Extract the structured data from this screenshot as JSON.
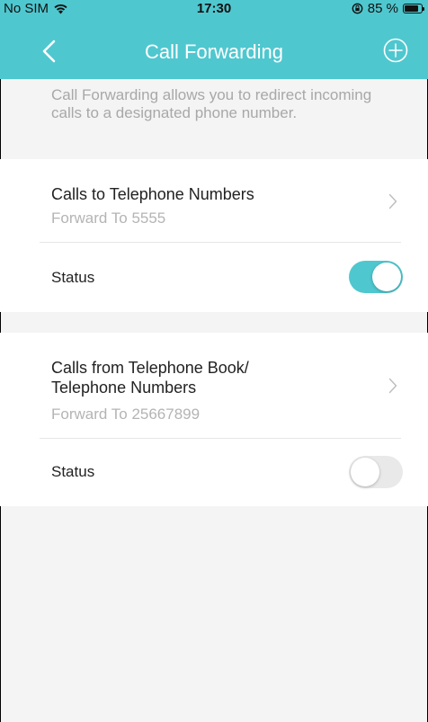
{
  "status_bar": {
    "carrier": "No SIM",
    "time": "17:30",
    "battery_text": "85 %",
    "battery_level": 0.85,
    "wifi_icon": "wifi-icon",
    "lock_icon": "orientation-lock-icon"
  },
  "header": {
    "title": "Call Forwarding",
    "back_icon": "chevron-left-icon",
    "add_icon": "plus-circle-icon",
    "color": "#4fc7cf"
  },
  "description": "Call Forwarding allows you to redirect incoming calls to a designated phone number.",
  "rules": [
    {
      "title": "Calls to Telephone Numbers",
      "subtitle": "Forward To 5555",
      "status_label": "Status",
      "status_on": true
    },
    {
      "title": "Calls from Telephone Book/ Telephone Numbers",
      "subtitle": "Forward To 25667899",
      "status_label": "Status",
      "status_on": false
    }
  ],
  "colors": {
    "accent": "#4fc7cf",
    "toggle_off": "#e9e9ea",
    "background": "#f4f4f4"
  }
}
